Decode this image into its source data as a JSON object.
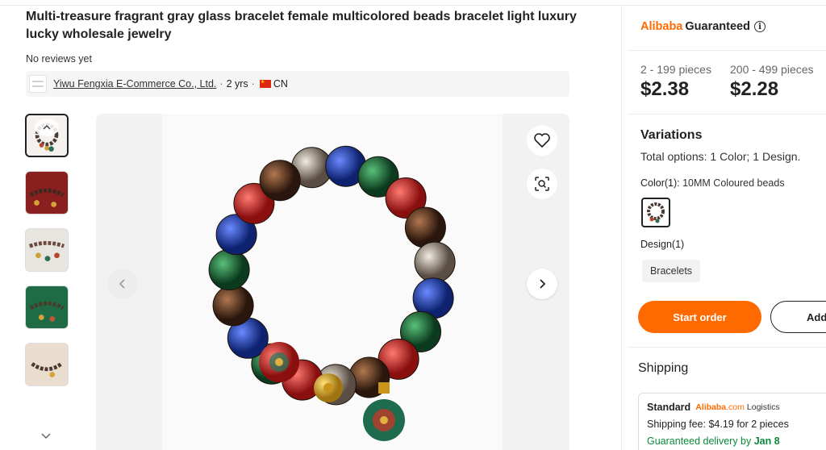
{
  "product": {
    "title": "Multi-treasure fragrant gray glass bracelet female multicolored beads bracelet light luxury lucky wholesale jewelry",
    "reviews": "No reviews yet"
  },
  "supplier": {
    "name": "Yiwu Fengxia E-Commerce Co., Ltd.",
    "separator": "·",
    "years": "2 yrs",
    "country": "CN"
  },
  "gallery": {
    "thumbnail_count": 5,
    "active_index": 0,
    "icons": [
      "heart-icon",
      "image-search-icon",
      "chevron-left-icon",
      "chevron-right-icon",
      "chevron-up-icon",
      "chevron-down-icon"
    ]
  },
  "guarantee": {
    "brand": "Alibaba",
    "label": "Guaranteed"
  },
  "pricing": [
    {
      "qty": "2 - 199 pieces",
      "price": "$2.38"
    },
    {
      "qty": "200 - 499 pieces",
      "price": "$2.28"
    }
  ],
  "variations": {
    "title": "Variations",
    "total_label": "Total options:",
    "total_value": "1 Color; 1 Design.",
    "color_label": "Color(1):",
    "color_value": "10MM Coloured beads",
    "design_label": "Design(1)",
    "design_option": "Bracelets"
  },
  "actions": {
    "start_order": "Start order",
    "add": "Add"
  },
  "shipping": {
    "title": "Shipping",
    "method": "Standard",
    "logistics_brand": "Alibaba",
    "logistics_domain": ".com",
    "logistics_label": "Logistics",
    "fee_text": "Shipping fee: $4.19 for 2 pieces",
    "delivery_label": "Guaranteed delivery by",
    "delivery_date": "Jan 8"
  },
  "colors": {
    "accent": "#ff6a00",
    "delivery_green": "#0c8a3a",
    "thumb_backgrounds": [
      "#f4f1ee",
      "#8a1f1f",
      "#e8e4e0",
      "#1f6b46",
      "#e9ddd0"
    ]
  }
}
